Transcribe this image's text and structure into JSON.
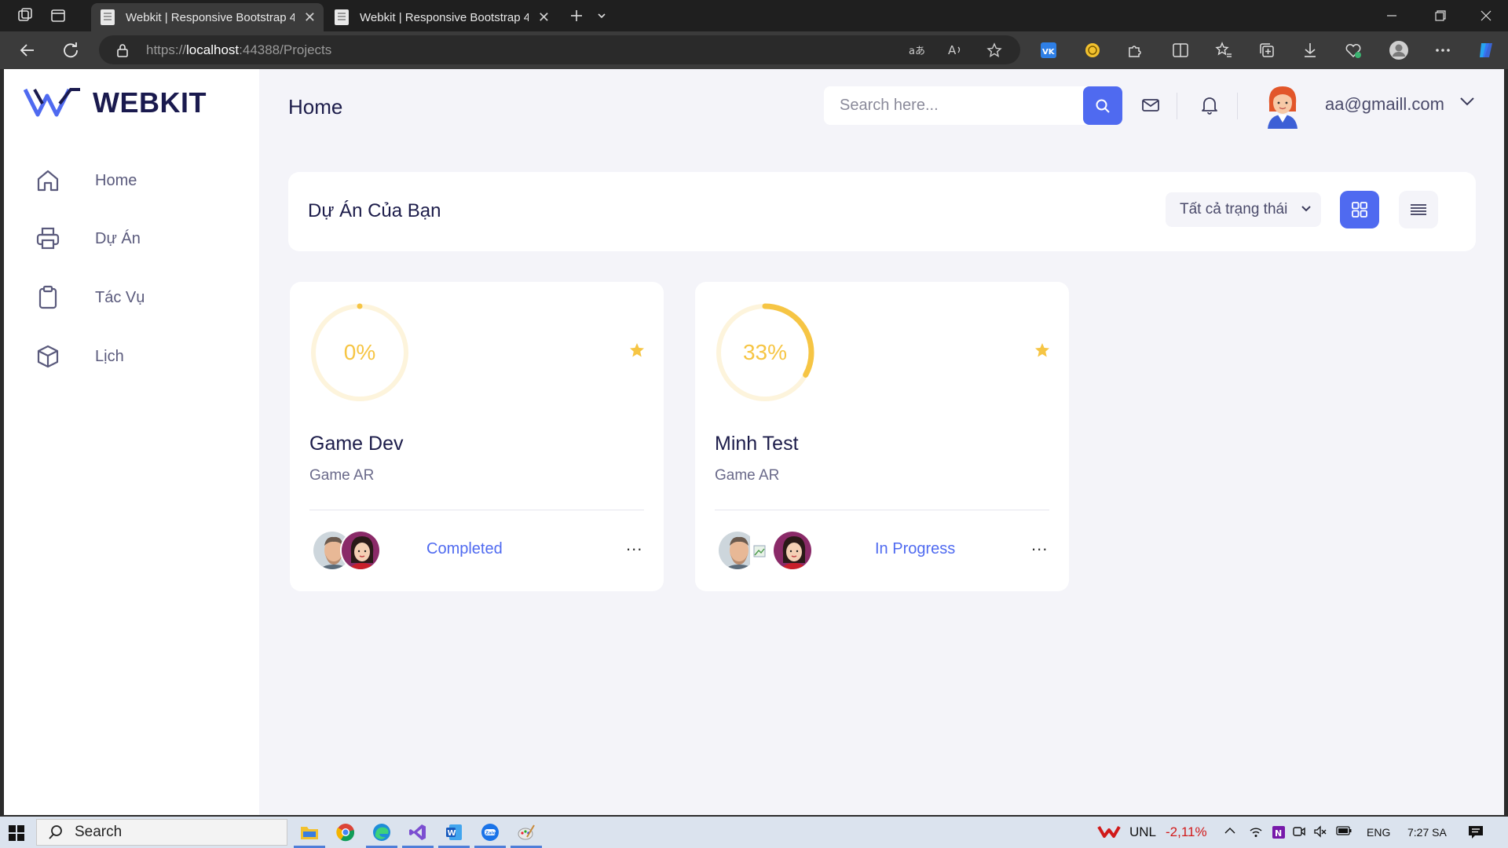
{
  "browser": {
    "tabs": [
      {
        "title": "Webkit | Responsive Bootstrap 4",
        "active": true
      },
      {
        "title": "Webkit | Responsive Bootstrap 4",
        "active": false
      }
    ],
    "url": {
      "scheme": "https://",
      "host": "localhost",
      "rest": ":44388/Projects"
    }
  },
  "sidebar": {
    "logo": "WEBKIT",
    "items": [
      {
        "label": "Home",
        "icon": "home-icon"
      },
      {
        "label": "Dự Án",
        "icon": "printer-icon"
      },
      {
        "label": "Tác Vụ",
        "icon": "clipboard-icon"
      },
      {
        "label": "Lịch",
        "icon": "cube-icon"
      }
    ]
  },
  "header": {
    "title": "Home",
    "search_placeholder": "Search here...",
    "user_email": "aa@gmaill.com"
  },
  "projects_header": {
    "title": "Dự Án Của Bạn",
    "status_filter": "Tất cả trạng thái"
  },
  "projects": [
    {
      "name": "Game Dev",
      "category": "Game AR",
      "progress": 0,
      "progress_label": "0%",
      "status": "Completed",
      "starred": true,
      "more": "..."
    },
    {
      "name": "Minh Test",
      "category": "Game AR",
      "progress": 33,
      "progress_label": "33%",
      "status": "In Progress",
      "starred": true,
      "more": "..."
    }
  ],
  "taskbar": {
    "search_label": "Search",
    "stock_name": "UNL",
    "stock_change": "-2,11%",
    "language": "ENG",
    "time": "7:27 SA"
  },
  "colors": {
    "accent": "#4f6af0",
    "progress": "#f6c544",
    "title_text": "#1c1c4a",
    "stock_down": "#d11a1a"
  }
}
